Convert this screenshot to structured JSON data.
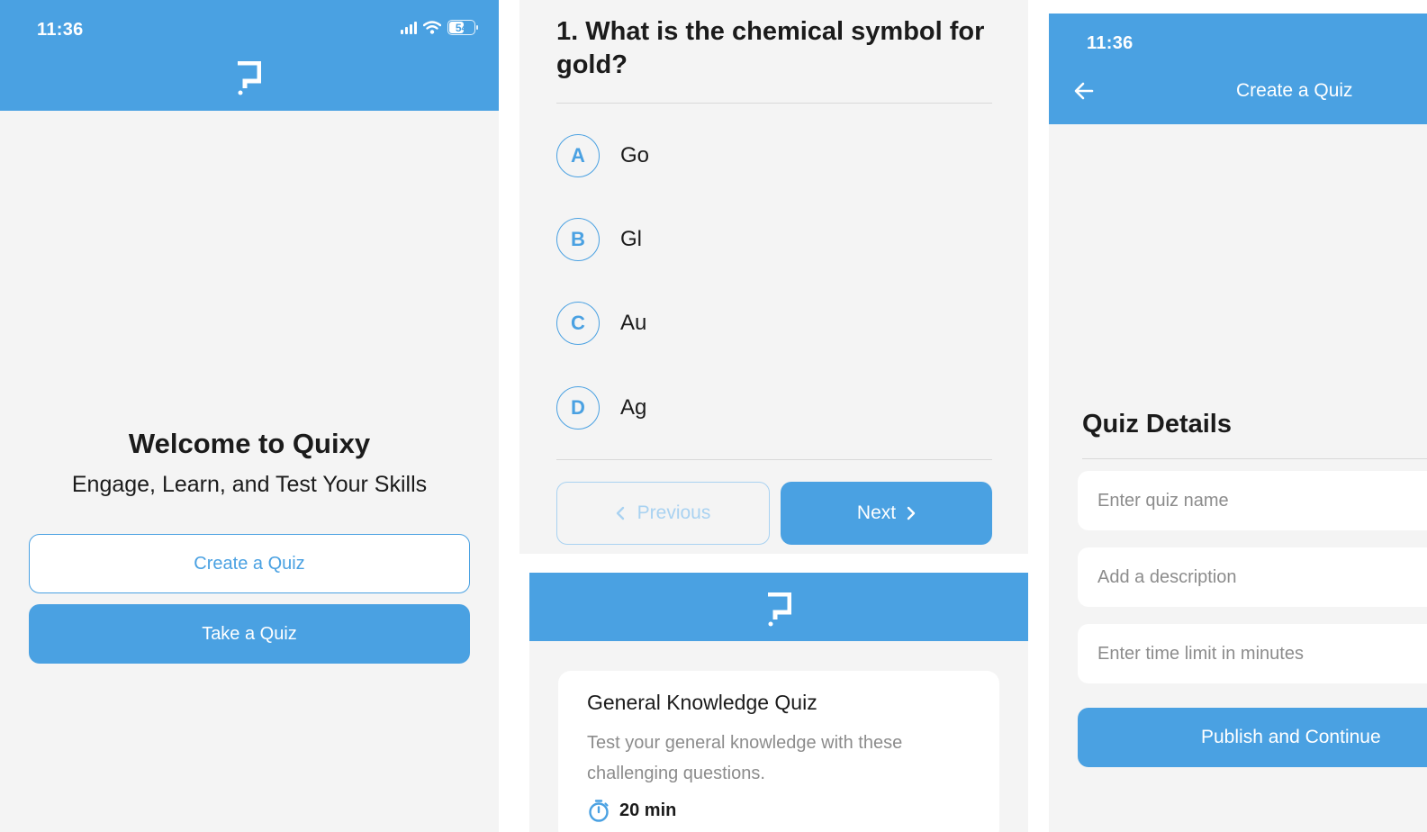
{
  "welcome_screen": {
    "status_time": "11:36",
    "battery": "54",
    "title": "Welcome to Quixy",
    "subtitle": "Engage, Learn, and Test Your Skills",
    "create_button": "Create a Quiz",
    "take_button": "Take a Quiz"
  },
  "question_screen": {
    "question": "1. What is the chemical symbol for gold?",
    "options": [
      {
        "letter": "A",
        "text": "Go"
      },
      {
        "letter": "B",
        "text": "Gl"
      },
      {
        "letter": "C",
        "text": "Au"
      },
      {
        "letter": "D",
        "text": "Ag"
      }
    ],
    "previous_label": "Previous",
    "next_label": "Next"
  },
  "quiz_list_screen": {
    "quiz": {
      "name": "General Knowledge Quiz",
      "description": "Test your general knowledge with these challenging questions.",
      "time_limit": "20 min"
    }
  },
  "create_screen": {
    "status_time": "11:36",
    "title": "Create a Quiz",
    "section_title": "Quiz Details",
    "fields": {
      "name_placeholder": "Enter quiz name",
      "description_placeholder": "Add a description",
      "time_placeholder": "Enter time limit in minutes"
    },
    "publish_label": "Publish and Continue"
  },
  "colors": {
    "primary": "#4aa1e2",
    "background": "#f4f4f4",
    "text": "#1b1b1b",
    "muted": "#8c8c8c"
  }
}
